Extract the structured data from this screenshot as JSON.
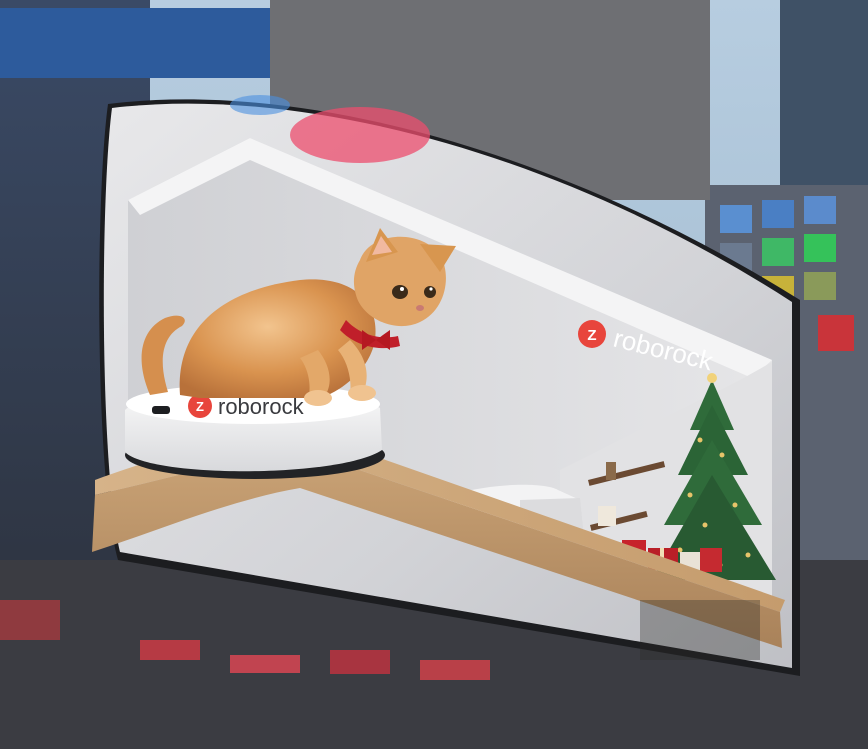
{
  "billboard": {
    "wall_brand": {
      "text": "roborock",
      "logo_letter": "Z"
    },
    "robot_brand": {
      "text": "roborock",
      "logo_letter": "Z"
    }
  },
  "colors": {
    "brand_red": "#e8453c",
    "sky": "#a9c2d8",
    "wall": "#d7d8dc",
    "wood": "#c9a578",
    "cat_fur": "#d99a5a",
    "tree_green": "#2f6b3a"
  },
  "scene": {
    "subjects": [
      "cat",
      "robot-vacuum",
      "christmas-tree",
      "gift-boxes",
      "sofa",
      "wall-shelves"
    ],
    "setting": "curved-led-billboard-on-city-building"
  }
}
